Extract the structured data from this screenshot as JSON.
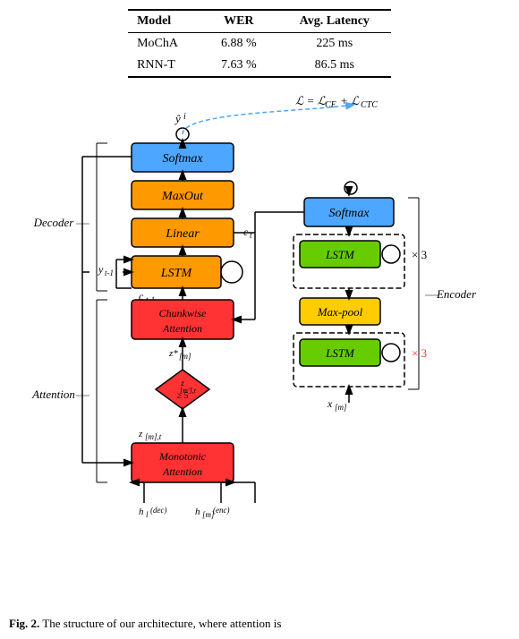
{
  "table": {
    "headers": [
      "Model",
      "WER",
      "Avg. Latency"
    ],
    "rows": [
      {
        "model": "MoChA",
        "wer": "6.88 %",
        "latency": "225 ms"
      },
      {
        "model": "RNN-T",
        "wer": "7.63 %",
        "latency": "86.5 ms"
      }
    ]
  },
  "diagram": {
    "formula": "ℒ = ℒ_CE + ℒ_CTC",
    "blocks": {
      "softmax_dec": "Softmax",
      "maxout": "MaxOut",
      "linear": "Linear",
      "lstm_dec": "LSTM",
      "chunkwise": "Chunkwise\nAttention",
      "diamond": "z_{[m'],t}",
      "monotonic": "Monotonic\nAttention",
      "softmax_enc": "Softmax",
      "lstm_enc_top": "LSTM",
      "maxpool": "Max-pool",
      "lstm_enc_bot": "LSTM"
    },
    "labels": {
      "decoder": "Decoder",
      "attention": "Attention",
      "encoder": "Encoder",
      "x3_top": "× 3",
      "x3_bot": "× 3",
      "y_hat": "ŷ_i",
      "y_prev": "y_{t-1}",
      "c_t": "c_t",
      "c_prev": "c_{t-1}",
      "z_m": "z^*_{[m]}",
      "z_ml": "z_{[m],t}",
      "h_dec": "h_l^{(dec)}",
      "h_enc": "h_{[m]}^{(enc)}",
      "x_m": "x_{[m]}"
    }
  },
  "caption": {
    "figure_label": "Fig. 2.",
    "text": "The structure of our architecture, where attention is"
  }
}
